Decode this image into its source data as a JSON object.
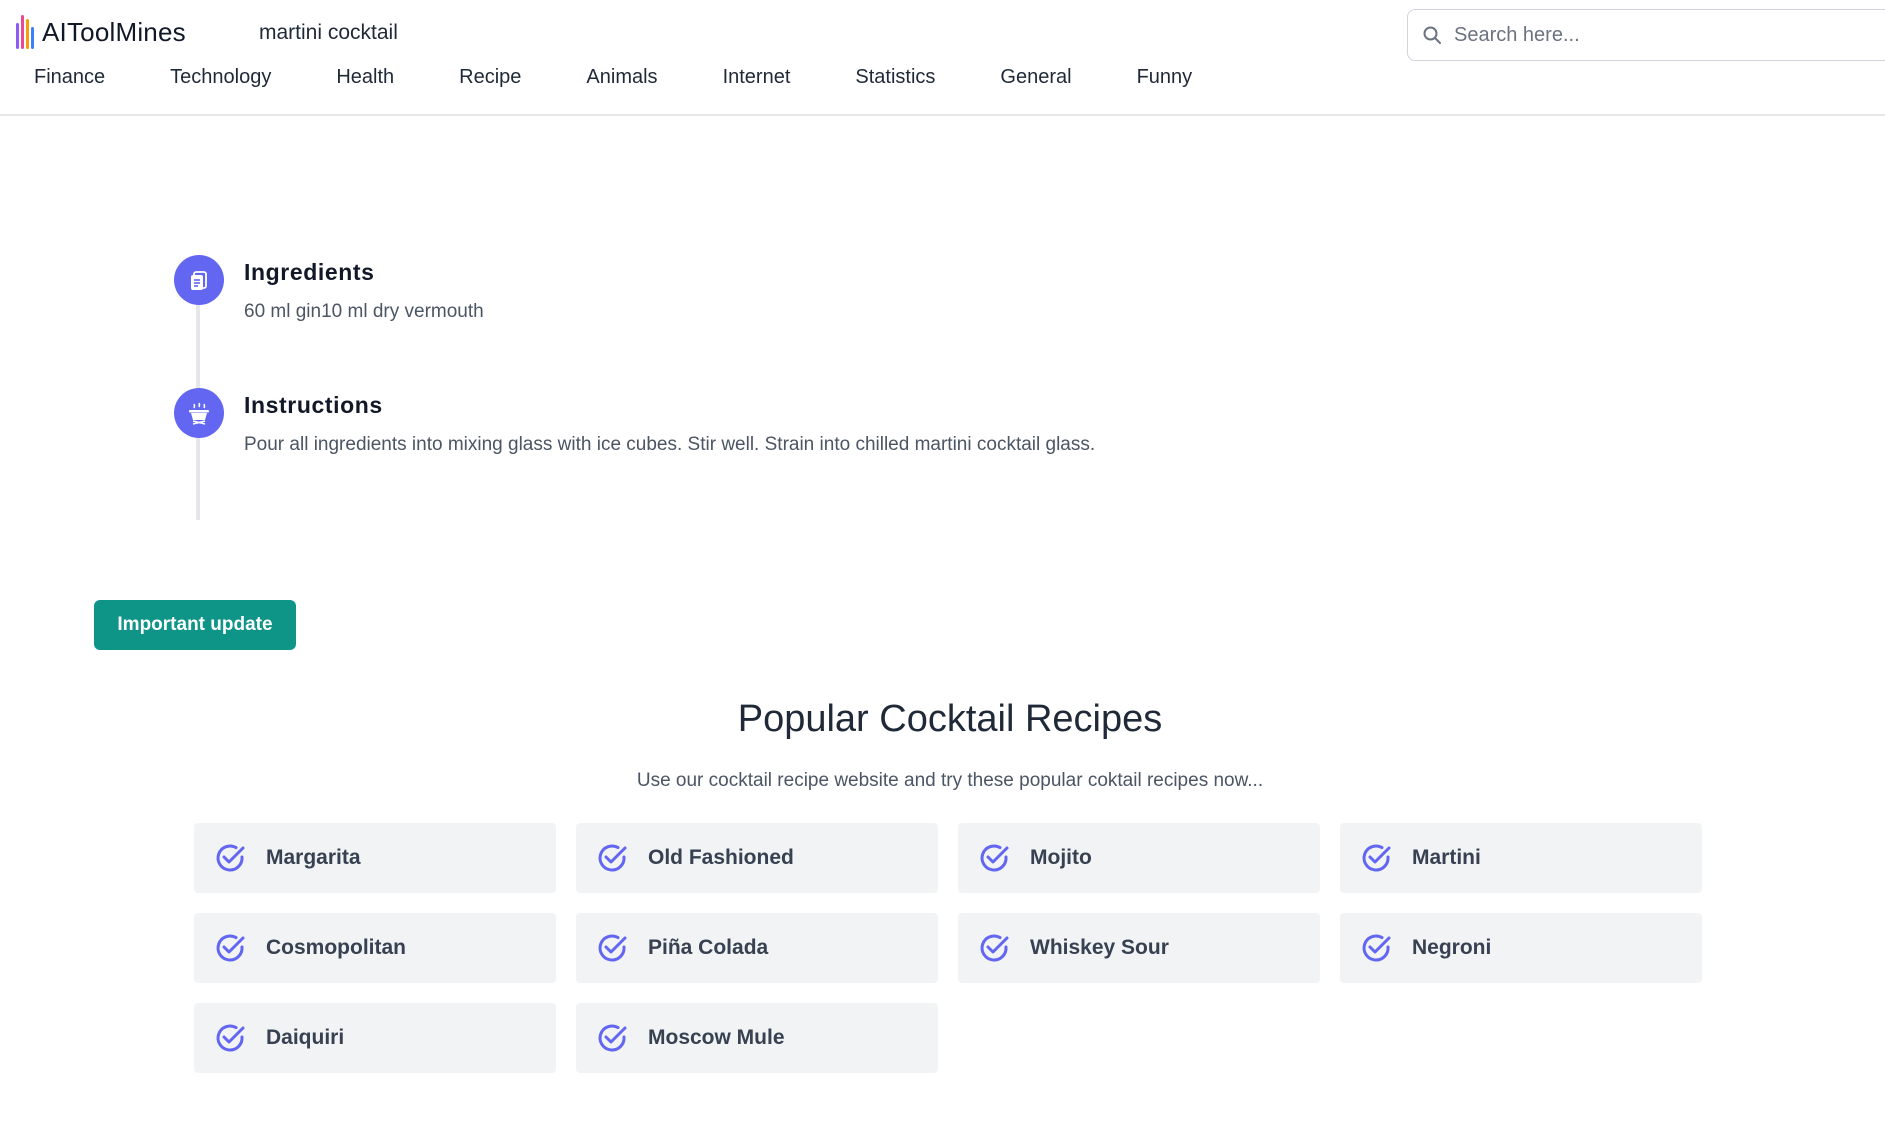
{
  "header": {
    "logo_text": "AIToolMines",
    "page_title": "martini cocktail",
    "search_placeholder": "Search here...",
    "nav": [
      "Finance",
      "Technology",
      "Health",
      "Recipe",
      "Animals",
      "Internet",
      "Statistics",
      "General",
      "Funny"
    ]
  },
  "steps": [
    {
      "title": "Ingredients",
      "text": "60 ml gin10 ml dry vermouth",
      "icon": "clipboard-icon"
    },
    {
      "title": "Instructions",
      "text": "Pour all ingredients into mixing glass with ice cubes. Stir well. Strain into chilled martini cocktail glass.",
      "icon": "cooking-pot-icon"
    }
  ],
  "update_button": "Important update",
  "popular": {
    "title": "Popular Cocktail Recipes",
    "subtitle": "Use our cocktail recipe website and try these popular coktail recipes now...",
    "items": [
      "Margarita",
      "Old Fashioned",
      "Mojito",
      "Martini",
      "Cosmopolitan",
      "Piña Colada",
      "Whiskey Sour",
      "Negroni",
      "Daiquiri",
      "Moscow Mule"
    ]
  },
  "colors": {
    "accent": "#6366f1",
    "button": "#0f9488",
    "card_bg": "#f1f3f5"
  }
}
